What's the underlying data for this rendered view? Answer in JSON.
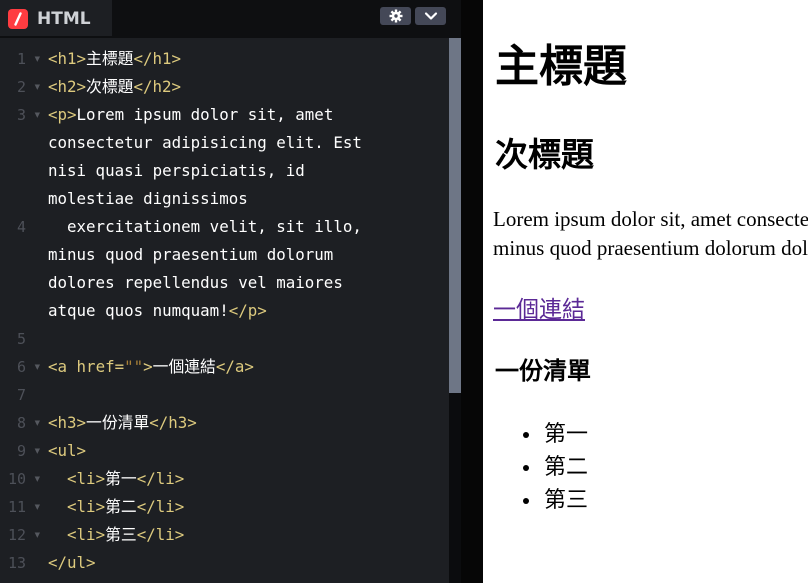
{
  "editor": {
    "tab_label": "HTML",
    "icons": {
      "settings": "gear-icon",
      "collapse": "chevron-down-icon",
      "logo": "codepen-html-icon"
    },
    "lines": [
      {
        "num": "1",
        "fold": true,
        "parts": [
          [
            "t",
            "<h1>"
          ],
          [
            "x",
            "主標題"
          ],
          [
            "t",
            "</h1>"
          ]
        ]
      },
      {
        "num": "2",
        "fold": true,
        "parts": [
          [
            "t",
            "<h2>"
          ],
          [
            "x",
            "次標題"
          ],
          [
            "t",
            "</h2>"
          ]
        ]
      },
      {
        "num": "3",
        "fold": true,
        "parts": [
          [
            "t",
            "<p>"
          ],
          [
            "x",
            "Lorem ipsum dolor sit, amet"
          ]
        ]
      },
      {
        "num": "",
        "fold": false,
        "parts": [
          [
            "x",
            "consectetur adipisicing elit. Est"
          ]
        ]
      },
      {
        "num": "",
        "fold": false,
        "parts": [
          [
            "x",
            "nisi quasi perspiciatis, id"
          ]
        ]
      },
      {
        "num": "",
        "fold": false,
        "parts": [
          [
            "x",
            "molestiae dignissimos"
          ]
        ]
      },
      {
        "num": "4",
        "fold": false,
        "parts": [
          [
            "x",
            "  exercitationem velit, sit illo,"
          ]
        ]
      },
      {
        "num": "",
        "fold": false,
        "parts": [
          [
            "x",
            "minus quod praesentium dolorum"
          ]
        ]
      },
      {
        "num": "",
        "fold": false,
        "parts": [
          [
            "x",
            "dolores repellendus vel maiores"
          ]
        ]
      },
      {
        "num": "",
        "fold": false,
        "parts": [
          [
            "x",
            "atque quos numquam!"
          ],
          [
            "t",
            "</p>"
          ]
        ]
      },
      {
        "num": "5",
        "fold": false,
        "parts": []
      },
      {
        "num": "6",
        "fold": true,
        "parts": [
          [
            "t",
            "<a "
          ],
          [
            "a",
            "href"
          ],
          [
            "t",
            "="
          ],
          [
            "s",
            "\"\""
          ],
          [
            "t",
            ">"
          ],
          [
            "x",
            "一個連結"
          ],
          [
            "t",
            "</a>"
          ]
        ]
      },
      {
        "num": "7",
        "fold": false,
        "parts": []
      },
      {
        "num": "8",
        "fold": true,
        "parts": [
          [
            "t",
            "<h3>"
          ],
          [
            "x",
            "一份清單"
          ],
          [
            "t",
            "</h3>"
          ]
        ]
      },
      {
        "num": "9",
        "fold": true,
        "parts": [
          [
            "t",
            "<ul>"
          ]
        ]
      },
      {
        "num": "10",
        "fold": true,
        "parts": [
          [
            "x",
            "  "
          ],
          [
            "t",
            "<li>"
          ],
          [
            "x",
            "第一"
          ],
          [
            "t",
            "</li>"
          ]
        ]
      },
      {
        "num": "11",
        "fold": true,
        "parts": [
          [
            "x",
            "  "
          ],
          [
            "t",
            "<li>"
          ],
          [
            "x",
            "第二"
          ],
          [
            "t",
            "</li>"
          ]
        ]
      },
      {
        "num": "12",
        "fold": true,
        "parts": [
          [
            "x",
            "  "
          ],
          [
            "t",
            "<li>"
          ],
          [
            "x",
            "第三"
          ],
          [
            "t",
            "</li>"
          ]
        ]
      },
      {
        "num": "13",
        "fold": false,
        "parts": [
          [
            "t",
            "</ul>"
          ]
        ]
      }
    ]
  },
  "preview": {
    "h1": "主標題",
    "h2": "次標題",
    "paragraph_line1": "Lorem ipsum dolor sit, amet consectetur",
    "paragraph_line2": "minus quod praesentium dolorum dolores",
    "link": "一個連結",
    "h3": "一份清單",
    "list": [
      "第一",
      "第二",
      "第三"
    ]
  },
  "colors": {
    "accent": "#ff3c41",
    "tag": "#ddca7e",
    "string": "#a88038",
    "link": "#5b2996"
  }
}
